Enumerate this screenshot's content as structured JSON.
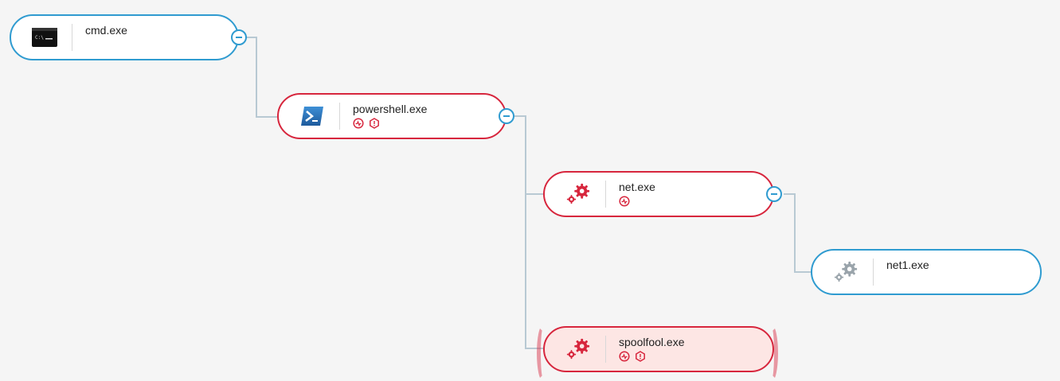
{
  "colors": {
    "background": "#f5f5f5",
    "normal_border": "#2f9bd0",
    "alert_border": "#d7263d",
    "alert_fill": "#fde6e4",
    "connector": "#b8c9d3"
  },
  "process_tree": {
    "nodes": [
      {
        "id": "cmd",
        "label": "cmd.exe",
        "icon": "console-icon",
        "state": "normal",
        "badges": [],
        "collapsible": true
      },
      {
        "id": "powershell",
        "label": "powershell.exe",
        "icon": "powershell-icon",
        "state": "suspicious",
        "badges": [
          "activity-badge-icon",
          "hexagon-alert-icon"
        ],
        "collapsible": true
      },
      {
        "id": "net",
        "label": "net.exe",
        "icon": "gears-icon",
        "state": "suspicious",
        "badges": [
          "activity-badge-icon"
        ],
        "collapsible": true
      },
      {
        "id": "net1",
        "label": "net1.exe",
        "icon": "gears-icon",
        "state": "normal",
        "badges": [],
        "collapsible": false
      },
      {
        "id": "spoolfool",
        "label": "spoolfool.exe",
        "icon": "gears-icon",
        "state": "selected-alert",
        "badges": [
          "activity-badge-icon",
          "hexagon-alert-icon"
        ],
        "collapsible": false
      }
    ]
  }
}
